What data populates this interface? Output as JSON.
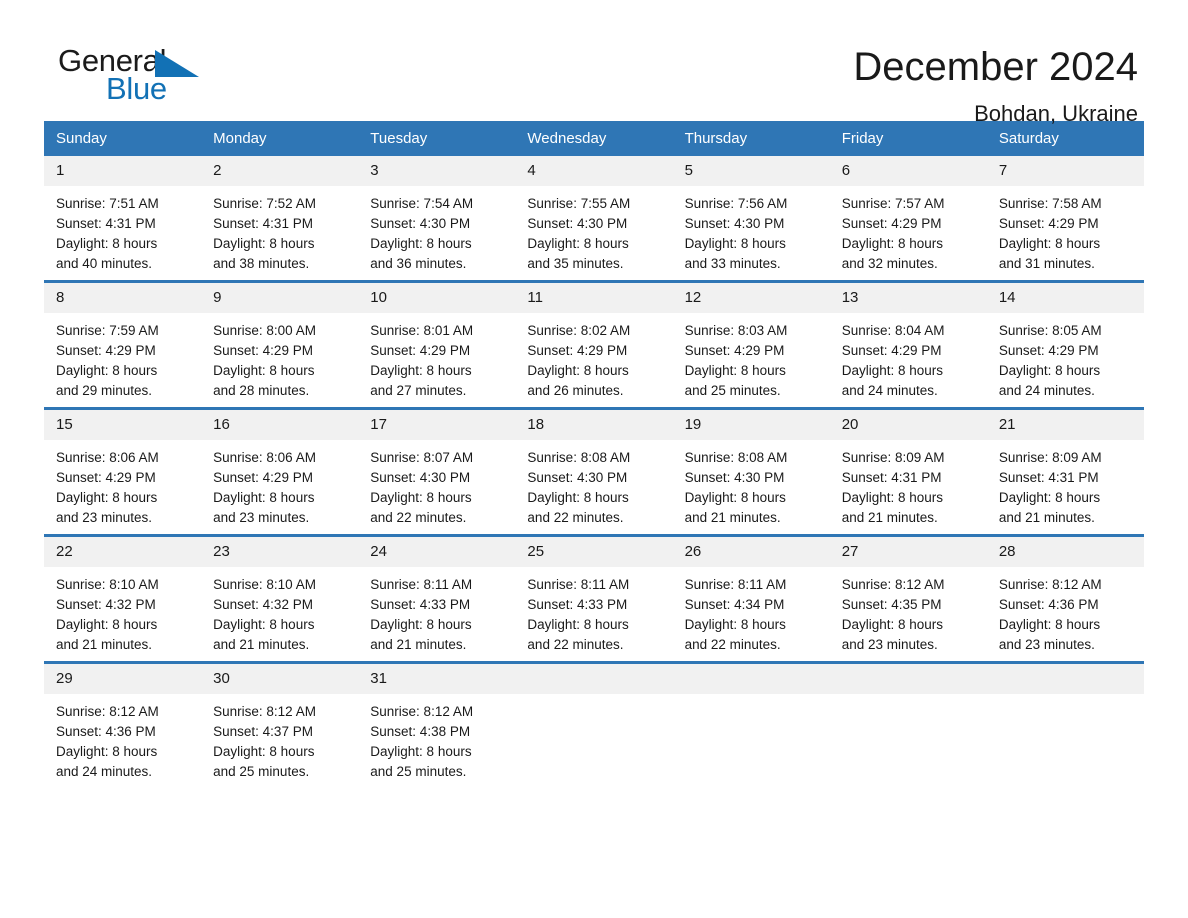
{
  "brand": {
    "word_one": "General",
    "word_two": "Blue",
    "triangle_color": "#1271b5"
  },
  "header": {
    "title": "December 2024",
    "subtitle": "Bohdan, Ukraine"
  },
  "theme": {
    "header_bg": "#2f76b5",
    "daynum_bg": "#f1f1f1",
    "text": "#1a1a1a",
    "page_bg": "#ffffff"
  },
  "weekday_headers": [
    "Sunday",
    "Monday",
    "Tuesday",
    "Wednesday",
    "Thursday",
    "Friday",
    "Saturday"
  ],
  "weeks": [
    [
      {
        "day": "1",
        "sunrise": "Sunrise: 7:51 AM",
        "sunset": "Sunset: 4:31 PM",
        "daylight_1": "Daylight: 8 hours",
        "daylight_2": "and 40 minutes."
      },
      {
        "day": "2",
        "sunrise": "Sunrise: 7:52 AM",
        "sunset": "Sunset: 4:31 PM",
        "daylight_1": "Daylight: 8 hours",
        "daylight_2": "and 38 minutes."
      },
      {
        "day": "3",
        "sunrise": "Sunrise: 7:54 AM",
        "sunset": "Sunset: 4:30 PM",
        "daylight_1": "Daylight: 8 hours",
        "daylight_2": "and 36 minutes."
      },
      {
        "day": "4",
        "sunrise": "Sunrise: 7:55 AM",
        "sunset": "Sunset: 4:30 PM",
        "daylight_1": "Daylight: 8 hours",
        "daylight_2": "and 35 minutes."
      },
      {
        "day": "5",
        "sunrise": "Sunrise: 7:56 AM",
        "sunset": "Sunset: 4:30 PM",
        "daylight_1": "Daylight: 8 hours",
        "daylight_2": "and 33 minutes."
      },
      {
        "day": "6",
        "sunrise": "Sunrise: 7:57 AM",
        "sunset": "Sunset: 4:29 PM",
        "daylight_1": "Daylight: 8 hours",
        "daylight_2": "and 32 minutes."
      },
      {
        "day": "7",
        "sunrise": "Sunrise: 7:58 AM",
        "sunset": "Sunset: 4:29 PM",
        "daylight_1": "Daylight: 8 hours",
        "daylight_2": "and 31 minutes."
      }
    ],
    [
      {
        "day": "8",
        "sunrise": "Sunrise: 7:59 AM",
        "sunset": "Sunset: 4:29 PM",
        "daylight_1": "Daylight: 8 hours",
        "daylight_2": "and 29 minutes."
      },
      {
        "day": "9",
        "sunrise": "Sunrise: 8:00 AM",
        "sunset": "Sunset: 4:29 PM",
        "daylight_1": "Daylight: 8 hours",
        "daylight_2": "and 28 minutes."
      },
      {
        "day": "10",
        "sunrise": "Sunrise: 8:01 AM",
        "sunset": "Sunset: 4:29 PM",
        "daylight_1": "Daylight: 8 hours",
        "daylight_2": "and 27 minutes."
      },
      {
        "day": "11",
        "sunrise": "Sunrise: 8:02 AM",
        "sunset": "Sunset: 4:29 PM",
        "daylight_1": "Daylight: 8 hours",
        "daylight_2": "and 26 minutes."
      },
      {
        "day": "12",
        "sunrise": "Sunrise: 8:03 AM",
        "sunset": "Sunset: 4:29 PM",
        "daylight_1": "Daylight: 8 hours",
        "daylight_2": "and 25 minutes."
      },
      {
        "day": "13",
        "sunrise": "Sunrise: 8:04 AM",
        "sunset": "Sunset: 4:29 PM",
        "daylight_1": "Daylight: 8 hours",
        "daylight_2": "and 24 minutes."
      },
      {
        "day": "14",
        "sunrise": "Sunrise: 8:05 AM",
        "sunset": "Sunset: 4:29 PM",
        "daylight_1": "Daylight: 8 hours",
        "daylight_2": "and 24 minutes."
      }
    ],
    [
      {
        "day": "15",
        "sunrise": "Sunrise: 8:06 AM",
        "sunset": "Sunset: 4:29 PM",
        "daylight_1": "Daylight: 8 hours",
        "daylight_2": "and 23 minutes."
      },
      {
        "day": "16",
        "sunrise": "Sunrise: 8:06 AM",
        "sunset": "Sunset: 4:29 PM",
        "daylight_1": "Daylight: 8 hours",
        "daylight_2": "and 23 minutes."
      },
      {
        "day": "17",
        "sunrise": "Sunrise: 8:07 AM",
        "sunset": "Sunset: 4:30 PM",
        "daylight_1": "Daylight: 8 hours",
        "daylight_2": "and 22 minutes."
      },
      {
        "day": "18",
        "sunrise": "Sunrise: 8:08 AM",
        "sunset": "Sunset: 4:30 PM",
        "daylight_1": "Daylight: 8 hours",
        "daylight_2": "and 22 minutes."
      },
      {
        "day": "19",
        "sunrise": "Sunrise: 8:08 AM",
        "sunset": "Sunset: 4:30 PM",
        "daylight_1": "Daylight: 8 hours",
        "daylight_2": "and 21 minutes."
      },
      {
        "day": "20",
        "sunrise": "Sunrise: 8:09 AM",
        "sunset": "Sunset: 4:31 PM",
        "daylight_1": "Daylight: 8 hours",
        "daylight_2": "and 21 minutes."
      },
      {
        "day": "21",
        "sunrise": "Sunrise: 8:09 AM",
        "sunset": "Sunset: 4:31 PM",
        "daylight_1": "Daylight: 8 hours",
        "daylight_2": "and 21 minutes."
      }
    ],
    [
      {
        "day": "22",
        "sunrise": "Sunrise: 8:10 AM",
        "sunset": "Sunset: 4:32 PM",
        "daylight_1": "Daylight: 8 hours",
        "daylight_2": "and 21 minutes."
      },
      {
        "day": "23",
        "sunrise": "Sunrise: 8:10 AM",
        "sunset": "Sunset: 4:32 PM",
        "daylight_1": "Daylight: 8 hours",
        "daylight_2": "and 21 minutes."
      },
      {
        "day": "24",
        "sunrise": "Sunrise: 8:11 AM",
        "sunset": "Sunset: 4:33 PM",
        "daylight_1": "Daylight: 8 hours",
        "daylight_2": "and 21 minutes."
      },
      {
        "day": "25",
        "sunrise": "Sunrise: 8:11 AM",
        "sunset": "Sunset: 4:33 PM",
        "daylight_1": "Daylight: 8 hours",
        "daylight_2": "and 22 minutes."
      },
      {
        "day": "26",
        "sunrise": "Sunrise: 8:11 AM",
        "sunset": "Sunset: 4:34 PM",
        "daylight_1": "Daylight: 8 hours",
        "daylight_2": "and 22 minutes."
      },
      {
        "day": "27",
        "sunrise": "Sunrise: 8:12 AM",
        "sunset": "Sunset: 4:35 PM",
        "daylight_1": "Daylight: 8 hours",
        "daylight_2": "and 23 minutes."
      },
      {
        "day": "28",
        "sunrise": "Sunrise: 8:12 AM",
        "sunset": "Sunset: 4:36 PM",
        "daylight_1": "Daylight: 8 hours",
        "daylight_2": "and 23 minutes."
      }
    ],
    [
      {
        "day": "29",
        "sunrise": "Sunrise: 8:12 AM",
        "sunset": "Sunset: 4:36 PM",
        "daylight_1": "Daylight: 8 hours",
        "daylight_2": "and 24 minutes."
      },
      {
        "day": "30",
        "sunrise": "Sunrise: 8:12 AM",
        "sunset": "Sunset: 4:37 PM",
        "daylight_1": "Daylight: 8 hours",
        "daylight_2": "and 25 minutes."
      },
      {
        "day": "31",
        "sunrise": "Sunrise: 8:12 AM",
        "sunset": "Sunset: 4:38 PM",
        "daylight_1": "Daylight: 8 hours",
        "daylight_2": "and 25 minutes."
      },
      {
        "day": "",
        "sunrise": "",
        "sunset": "",
        "daylight_1": "",
        "daylight_2": ""
      },
      {
        "day": "",
        "sunrise": "",
        "sunset": "",
        "daylight_1": "",
        "daylight_2": ""
      },
      {
        "day": "",
        "sunrise": "",
        "sunset": "",
        "daylight_1": "",
        "daylight_2": ""
      },
      {
        "day": "",
        "sunrise": "",
        "sunset": "",
        "daylight_1": "",
        "daylight_2": ""
      }
    ]
  ]
}
